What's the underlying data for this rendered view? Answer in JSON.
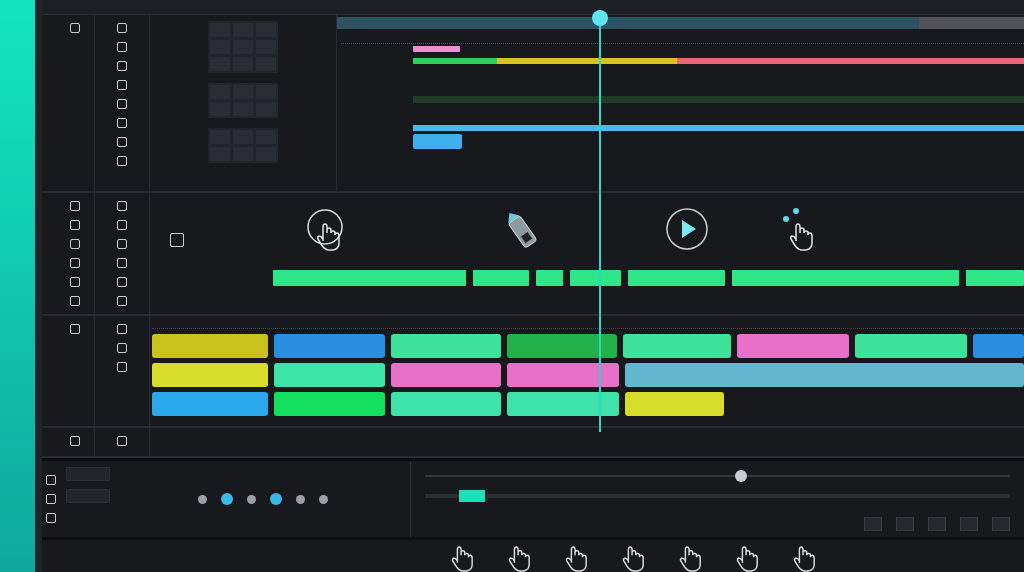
{
  "progress_segments": [
    {
      "color": "#2fcf5a"
    },
    {
      "color": "#dcc221"
    },
    {
      "color": "#e8677a"
    }
  ],
  "gesture_icons": [
    {
      "kind": "hand"
    },
    {
      "kind": "pen"
    },
    {
      "kind": "play"
    },
    {
      "kind": "pointer"
    }
  ],
  "clip_lanes": [
    {
      "clips": [
        {
          "color": "#c9c21c"
        },
        {
          "color": "#2a8ee0"
        },
        {
          "color": "#3de39a"
        },
        {
          "color": "#22b04a"
        },
        {
          "color": "#3de39a"
        },
        {
          "color": "#e870c8"
        },
        {
          "color": "#3de39a"
        },
        {
          "color": "#2a8ee0"
        }
      ]
    },
    {
      "clips": [
        {
          "color": "#d8dc2a"
        },
        {
          "color": "#3de3a8"
        },
        {
          "color": "#e870c8"
        },
        {
          "color": "#e870c8"
        },
        {
          "color": "#62b6d0"
        }
      ]
    },
    {
      "clips": [
        {
          "color": "#2aa8ec"
        },
        {
          "color": "#14e060"
        },
        {
          "color": "#3de3a8"
        },
        {
          "color": "#3de3a8"
        },
        {
          "color": "#d8dc2a"
        }
      ]
    }
  ],
  "bottom_slider": {
    "level": 0.08
  },
  "top_slider": {
    "level": 0.54
  },
  "cursor_icons": [
    {
      "kind": "hand"
    },
    {
      "kind": "hand"
    },
    {
      "kind": "hand"
    },
    {
      "kind": "hand"
    },
    {
      "kind": "hand"
    },
    {
      "kind": "hand"
    },
    {
      "kind": "hand"
    }
  ]
}
